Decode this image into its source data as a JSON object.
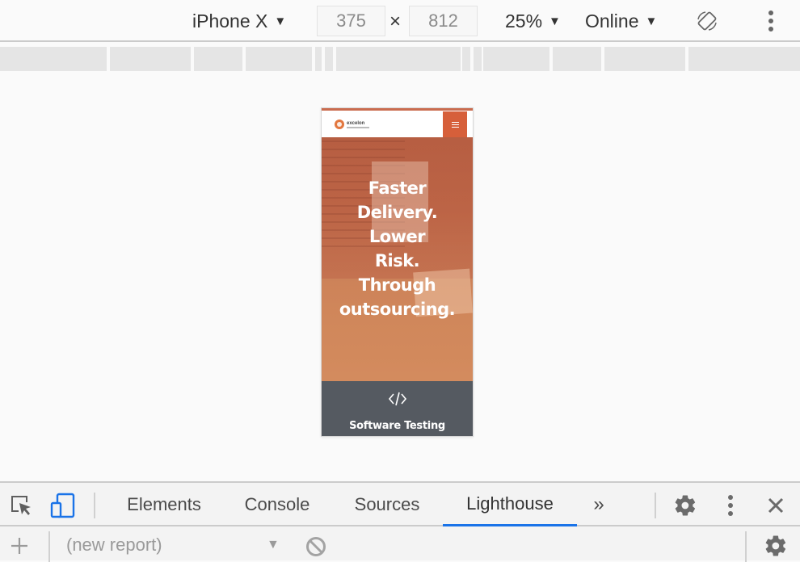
{
  "device_toolbar": {
    "device": "iPhone X",
    "width": "375",
    "height": "812",
    "dimension_separator": "×",
    "zoom": "25%",
    "network": "Online",
    "caret": "▼",
    "icons": {
      "rotate": "rotate-icon",
      "more": "more-vertical-icon"
    }
  },
  "site": {
    "logo_text": "excelon",
    "accent_color": "#d65f3a",
    "hero_lines": [
      "Faster",
      "Delivery.",
      "Lower",
      "Risk.",
      "Through",
      "outsourcing."
    ],
    "service_label": "Software Testing",
    "service_icon": "code-icon"
  },
  "devtools": {
    "tabs": [
      {
        "label": "Elements",
        "active": false
      },
      {
        "label": "Console",
        "active": false
      },
      {
        "label": "Sources",
        "active": false
      },
      {
        "label": "Lighthouse",
        "active": true
      }
    ],
    "overflow_label": "»",
    "accent_color": "#1a73e8",
    "report_select": "(new report)"
  }
}
